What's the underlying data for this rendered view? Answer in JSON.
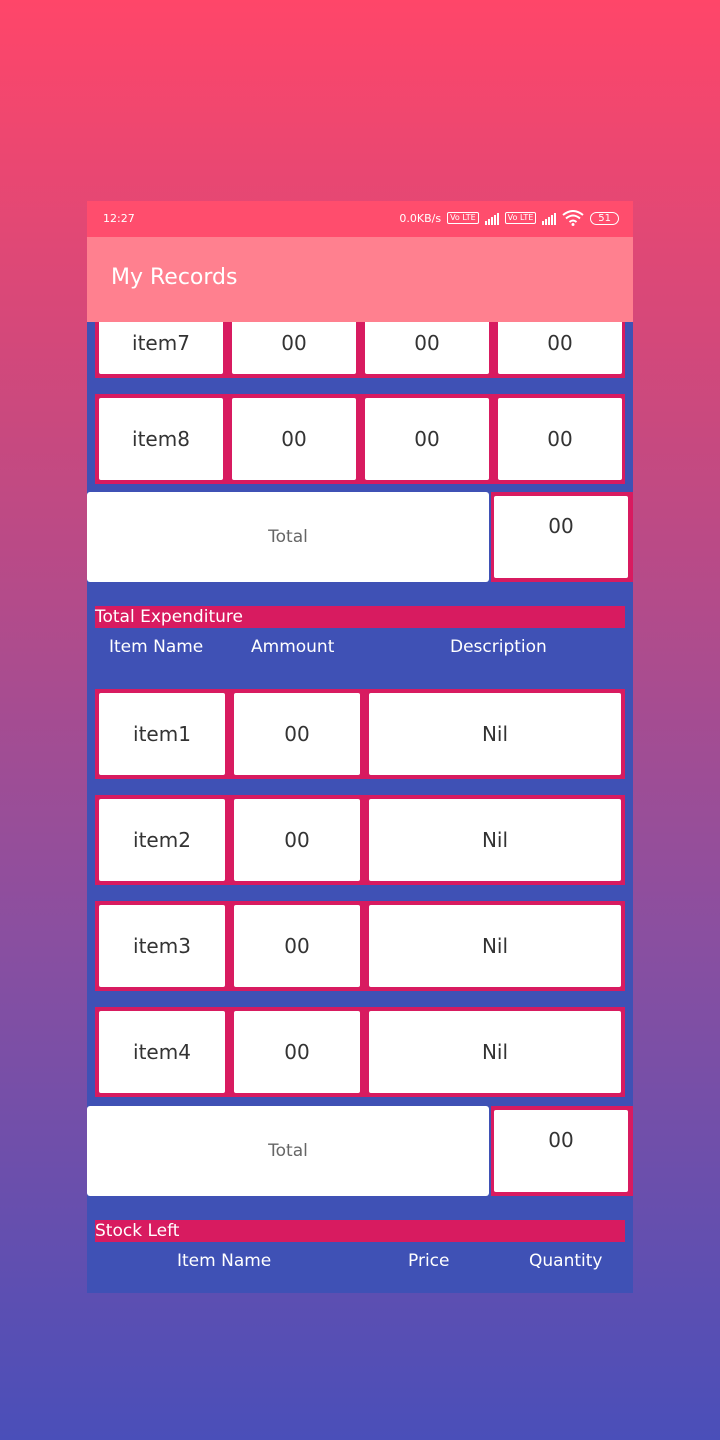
{
  "status_bar": {
    "time": "12:27",
    "net_speed": "0.0KB/s",
    "volte_1": "Vo LTE",
    "volte_2": "Vo LTE",
    "battery": "51"
  },
  "app_bar": {
    "title": "My Records"
  },
  "purchases": {
    "rows": [
      {
        "name": "item7",
        "c1": "00",
        "c2": "00",
        "c3": "00"
      },
      {
        "name": "item8",
        "c1": "00",
        "c2": "00",
        "c3": "00"
      }
    ],
    "total_label": "Total",
    "total_value": "00"
  },
  "expenditure": {
    "title": "Total Expenditure",
    "headers": {
      "name": "Item Name",
      "amount": "Ammount",
      "description": "Description"
    },
    "rows": [
      {
        "name": "item1",
        "amount": "00",
        "description": "Nil"
      },
      {
        "name": "item2",
        "amount": "00",
        "description": "Nil"
      },
      {
        "name": "item3",
        "amount": "00",
        "description": "Nil"
      },
      {
        "name": "item4",
        "amount": "00",
        "description": "Nil"
      }
    ],
    "total_label": "Total",
    "total_value": "00"
  },
  "stock": {
    "title": "Stock Left",
    "headers": {
      "name": "Item Name",
      "price": "Price",
      "quantity": "Quantity"
    }
  },
  "colors": {
    "accent": "#d81b60",
    "primary": "#3f51b5",
    "app_bar": "#ff808f",
    "status_bar": "#ff4d6d"
  }
}
